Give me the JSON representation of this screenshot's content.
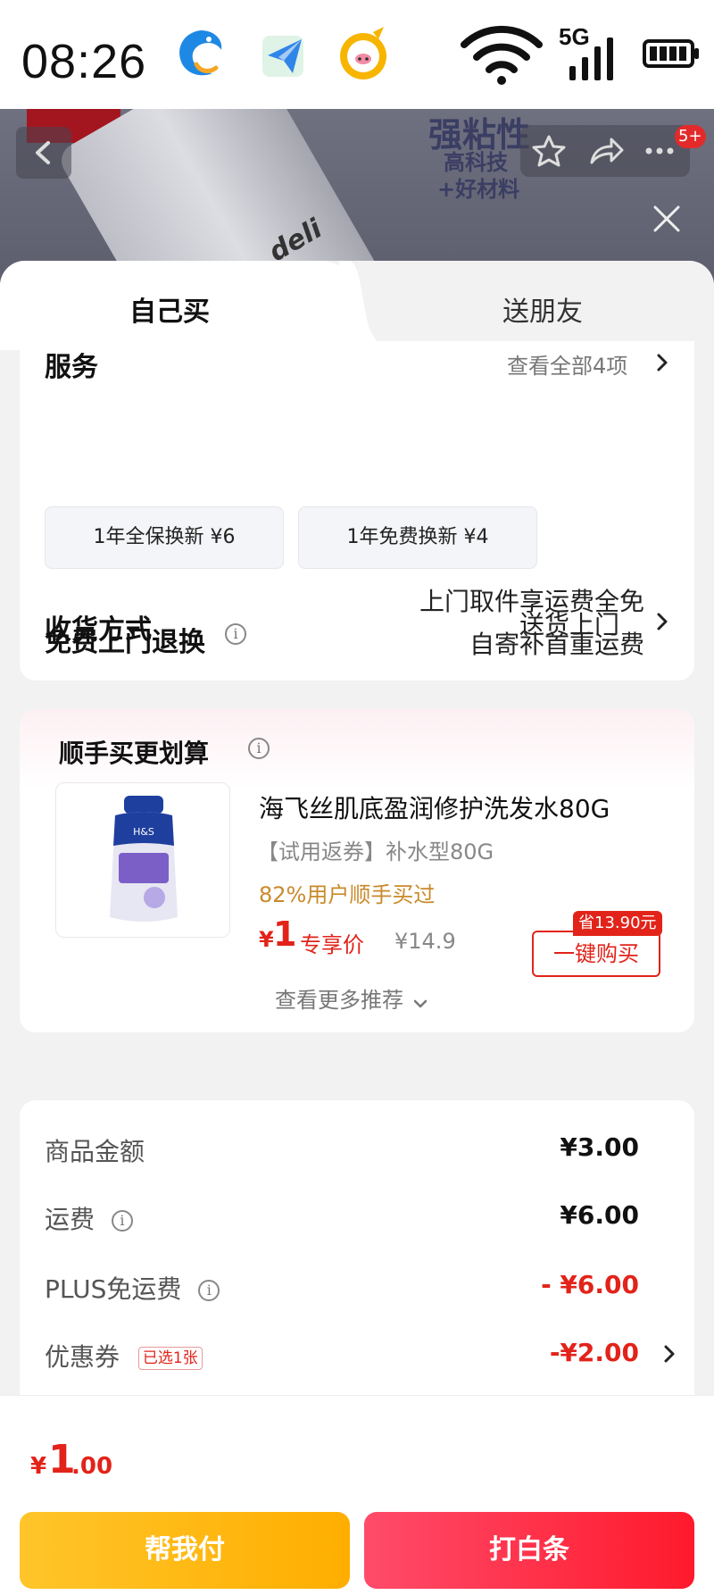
{
  "status_bar": {
    "time": "08:26",
    "network": "5G"
  },
  "hero": {
    "promo_title": "强粘性",
    "promo_line1": "高科技",
    "promo_line2": "+好材料",
    "product_text": "deli",
    "cart_badge": "5+"
  },
  "tabs": {
    "self": "自己买",
    "gift": "送朋友"
  },
  "service": {
    "title": "服务",
    "view_all": "查看全部4项",
    "chips": [
      "1年全保换新 ¥6",
      "1年免费换新 ¥4"
    ]
  },
  "delivery": {
    "label": "收货方式",
    "value": "送货上门"
  },
  "returns": {
    "label": "免费上门退换",
    "line1": "上门取件享运费全免",
    "line2": "自寄补首重运费"
  },
  "recommend": {
    "title": "顺手买更划算",
    "product_name": "海飞丝肌底盈润修护洗发水80G",
    "spec": "【试用返券】补水型80G",
    "stat": "82%用户顺手买过",
    "price_currency": "¥",
    "price": "1",
    "price_tag": "专享价",
    "original_price": "¥14.9",
    "save_badge": "省13.90元",
    "buy_button": "一键购买",
    "more": "查看更多推荐"
  },
  "summary": {
    "rows": [
      {
        "label": "商品金额",
        "value": "¥3.00"
      },
      {
        "label": "运费",
        "value": "¥6.00"
      },
      {
        "label": "PLUS免运费",
        "value": "- ¥6.00"
      },
      {
        "label": "优惠券",
        "chip": "已选1张",
        "value": "-¥2.00"
      }
    ]
  },
  "footer": {
    "total_currency": "¥",
    "total_int": "1",
    "total_dec": ".00",
    "help_pay": "帮我付",
    "pay_button": "打白条"
  },
  "colors": {
    "accent_red": "#e2231a",
    "help_yellow": "#ffb800",
    "pay_red": "#ff2a3c"
  }
}
